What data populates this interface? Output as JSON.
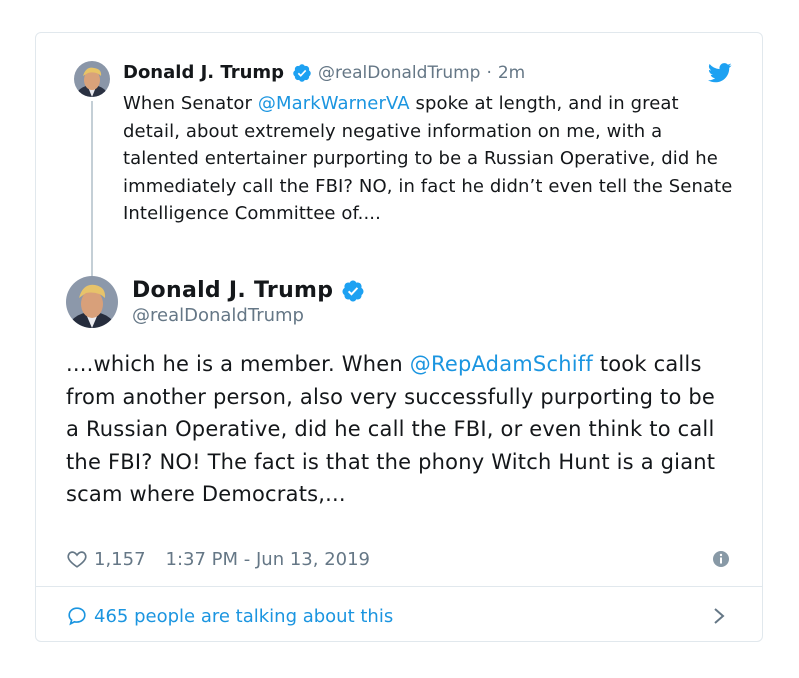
{
  "parent_tweet": {
    "name": "Donald J. Trump",
    "handle": "@realDonaldTrump",
    "separator": "·",
    "time_ago": "2m",
    "text_before": "When Senator ",
    "mention": "@MarkWarnerVA",
    "text_after": " spoke at length, and in great detail, about extremely negative information on me, with a talented entertainer purporting to be a Russian Operative, did he immediately call the FBI? NO, in fact he didn’t even tell the Senate Intelligence Committee of....",
    "verified_icon": "verified-badge-icon",
    "platform_icon": "twitter-bird-icon"
  },
  "main_tweet": {
    "name": "Donald J. Trump",
    "handle": "@realDonaldTrump",
    "text_before": "....which he is a member. When ",
    "mention": "@RepAdamSchiff",
    "text_after": " took calls from another person, also very successfully purporting to be a Russian Operative, did he call the FBI, or even think to call the FBI? NO! The fact is that the phony Witch Hunt is a giant scam where Democrats,...",
    "likes": "1,157",
    "timestamp": "1:37 PM - Jun 13, 2019",
    "verified_icon": "verified-badge-icon"
  },
  "footer": {
    "talking_text": "465 people are talking about this",
    "talk_icon": "speech-bubble-icon",
    "chevron_icon": "chevron-right-icon"
  },
  "colors": {
    "link": "#1b95e0",
    "secondary_text": "#657786",
    "border": "#e1e8ed",
    "text": "#14171a"
  }
}
